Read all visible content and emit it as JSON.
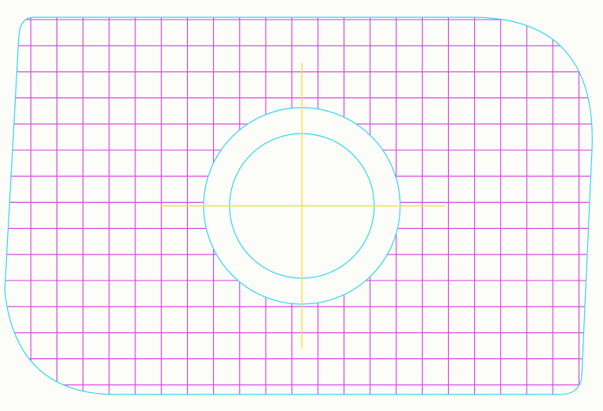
{
  "drawing": {
    "background": "#fcfdf8",
    "colors": {
      "outline": "#33d6f0",
      "hatch": "#d63adf",
      "centerline": "#e8e64a"
    },
    "parts": [
      {
        "name": "plate-outline",
        "kind": "rounded-quadrilateral"
      },
      {
        "name": "outer-bore",
        "kind": "circle"
      },
      {
        "name": "inner-bore",
        "kind": "circle"
      },
      {
        "name": "cross-hatch",
        "kind": "grid-fill"
      },
      {
        "name": "centerlines",
        "kind": "crosshair"
      }
    ]
  }
}
